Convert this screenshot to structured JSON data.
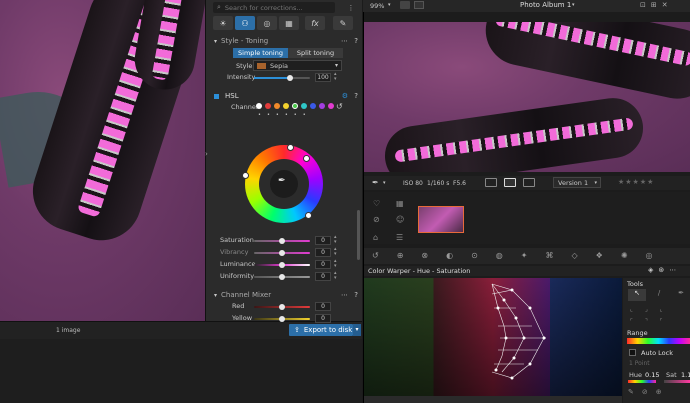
{
  "left": {
    "footer_count": "1 image",
    "export_label": "Export to disk",
    "search_placeholder": "Search for corrections..."
  },
  "toning": {
    "header": "Style - Toning",
    "tab_simple": "Simple toning",
    "tab_split": "Split toning",
    "style_label": "Style",
    "style_value": "Sepia",
    "intensity_label": "Intensity",
    "intensity_value": "100",
    "intensity_level": 0.62
  },
  "hsl": {
    "header": "HSL",
    "channel_label": "Channel",
    "channel_colors": [
      "#ffffff",
      "#e23b3b",
      "#f08a2a",
      "#f2d22e",
      "#4cc94c",
      "#2fc7c7",
      "#3a5ae8",
      "#a23ee0",
      "#e23bd0"
    ],
    "rows": [
      {
        "label": "Saturation",
        "value": "0",
        "level": 0.5
      },
      {
        "label": "Vibrancy",
        "value": "0",
        "level": 0.5
      },
      {
        "label": "Luminance",
        "value": "0",
        "level": 0.5
      },
      {
        "label": "Uniformity",
        "value": "0",
        "level": 0.5
      }
    ]
  },
  "mixer": {
    "header": "Channel Mixer",
    "rows": [
      {
        "label": "Red",
        "value": "0"
      },
      {
        "label": "Yellow",
        "value": "0"
      }
    ]
  },
  "right": {
    "zoom": "99%",
    "title": "Photo Album 1",
    "iso": "ISO 80",
    "shutter": "1/160 s",
    "fstop": "F5.6",
    "version": "Version 1",
    "warper_title": "Color Warper - Hue - Saturation",
    "tools_label": "Tools",
    "range_label": "Range",
    "autolock_label": "Auto Lock",
    "point_label": "1 Point",
    "hue_label": "Hue",
    "hue_value": "0.15",
    "sat_label": "Sat",
    "sat_value": "1.1"
  }
}
